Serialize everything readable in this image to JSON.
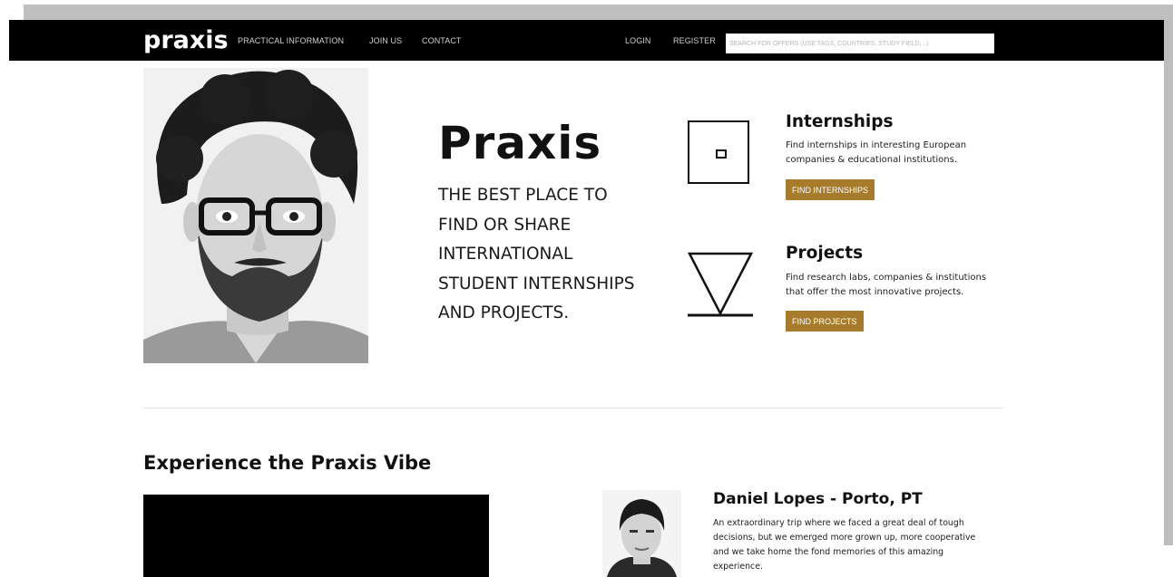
{
  "navbar": {
    "logo": "praxis",
    "links": [
      "PRACTICAL INFORMATION",
      "JOIN US",
      "CONTACT"
    ],
    "login": "LOGIN",
    "register": "REGISTER",
    "search_placeholder": "SEARCH FOR OFFERS (USE TAGS, COUNTRIES, STUDY FIELD, ..)"
  },
  "hero": {
    "title": "Praxis",
    "tagline_lines": [
      "THE BEST PLACE TO",
      "FIND OR SHARE",
      "INTERNATIONAL",
      "STUDENT INTERNSHIPS",
      "AND PROJECTS."
    ]
  },
  "internships": {
    "icon": "square-icon",
    "title": "Internships",
    "description": "Find internships in interesting European companies & educational institutions.",
    "button": "FIND INTERNSHIPS"
  },
  "projects": {
    "icon": "triangle-icon",
    "title": "Projects",
    "description": "Find research labs, companies & institutions that offer the most innovative projects.",
    "button": "FIND PROJECTS"
  },
  "vibe": {
    "title": "Experience the Praxis Vibe"
  },
  "testimonial": {
    "name": "Daniel Lopes - Porto, PT",
    "text": "An extraordinary trip where we faced a great deal of tough decisions, but we emerged more grown up, more cooperative and we take home the fond memories of this amazing experience."
  },
  "colors": {
    "accent": "#a77b2c",
    "navbar": "#000000"
  }
}
